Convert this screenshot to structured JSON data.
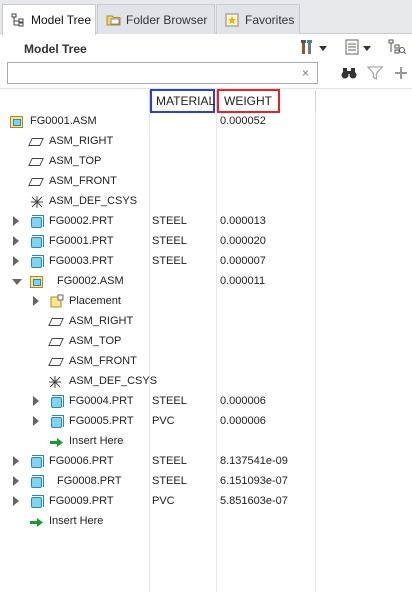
{
  "tabs": [
    {
      "label": "Model Tree",
      "icon": "model-tree-icon"
    },
    {
      "label": "Folder Browser",
      "icon": "folder-icon"
    },
    {
      "label": "Favorites",
      "icon": "favorites-icon"
    }
  ],
  "panel": {
    "title": "Model Tree",
    "tools": [
      "settings-icon",
      "show-icon",
      "layout-icon"
    ]
  },
  "search": {
    "value": "",
    "placeholder": "",
    "clear_symbol": "×"
  },
  "columns": {
    "material": "MATERIAL",
    "weight": "WEIGHT"
  },
  "highlight_colors": {
    "material": "#2f3fcf",
    "weight": "#e3222d"
  },
  "rows": [
    {
      "label": "FG0001.ASM",
      "icon": "assembly-icon",
      "expander": "",
      "material": "",
      "weight": "0.000052"
    },
    {
      "label": "ASM_RIGHT",
      "icon": "datum-plane-icon",
      "expander": "",
      "material": "",
      "weight": ""
    },
    {
      "label": "ASM_TOP",
      "icon": "datum-plane-icon",
      "expander": "",
      "material": "",
      "weight": ""
    },
    {
      "label": "ASM_FRONT",
      "icon": "datum-plane-icon",
      "expander": "",
      "material": "",
      "weight": ""
    },
    {
      "label": "ASM_DEF_CSYS",
      "icon": "coordinate-system-icon",
      "expander": "",
      "material": "",
      "weight": ""
    },
    {
      "label": "FG0002.PRT",
      "icon": "part-icon",
      "expander": "right",
      "material": "STEEL",
      "weight": "0.000013"
    },
    {
      "label": "FG0001.PRT",
      "icon": "part-icon",
      "expander": "right",
      "material": "STEEL",
      "weight": "0.000020"
    },
    {
      "label": "FG0003.PRT",
      "icon": "part-icon",
      "expander": "right",
      "material": "STEEL",
      "weight": "0.000007"
    },
    {
      "label": "FG0002.ASM",
      "icon": "assembly-icon",
      "expander": "down",
      "material": "",
      "weight": "0.000011"
    },
    {
      "label": "Placement",
      "icon": "placement-icon",
      "expander": "right",
      "material": "",
      "weight": ""
    },
    {
      "label": "ASM_RIGHT",
      "icon": "datum-plane-icon",
      "expander": "",
      "material": "",
      "weight": ""
    },
    {
      "label": "ASM_TOP",
      "icon": "datum-plane-icon",
      "expander": "",
      "material": "",
      "weight": ""
    },
    {
      "label": "ASM_FRONT",
      "icon": "datum-plane-icon",
      "expander": "",
      "material": "",
      "weight": ""
    },
    {
      "label": "ASM_DEF_CSYS",
      "icon": "coordinate-system-icon",
      "expander": "",
      "material": "",
      "weight": ""
    },
    {
      "label": "FG0004.PRT",
      "icon": "part-icon",
      "expander": "right",
      "material": "STEEL",
      "weight": "0.000006"
    },
    {
      "label": "FG0005.PRT",
      "icon": "part-icon",
      "expander": "right",
      "material": "PVC",
      "weight": "0.000006"
    },
    {
      "label": "Insert Here",
      "icon": "insert-arrow-icon",
      "expander": "",
      "material": "",
      "weight": ""
    },
    {
      "label": "FG0006.PRT",
      "icon": "part-icon",
      "expander": "right",
      "material": "STEEL",
      "weight": "8.137541e-09"
    },
    {
      "label": "FG0008.PRT",
      "icon": "part-icon",
      "expander": "right",
      "material": "STEEL",
      "weight": "6.151093e-07"
    },
    {
      "label": "FG0009.PRT",
      "icon": "part-icon",
      "expander": "right",
      "material": "PVC",
      "weight": "5.851603e-07"
    },
    {
      "label": "Insert Here",
      "icon": "insert-arrow-icon",
      "expander": "",
      "material": "",
      "weight": ""
    }
  ]
}
